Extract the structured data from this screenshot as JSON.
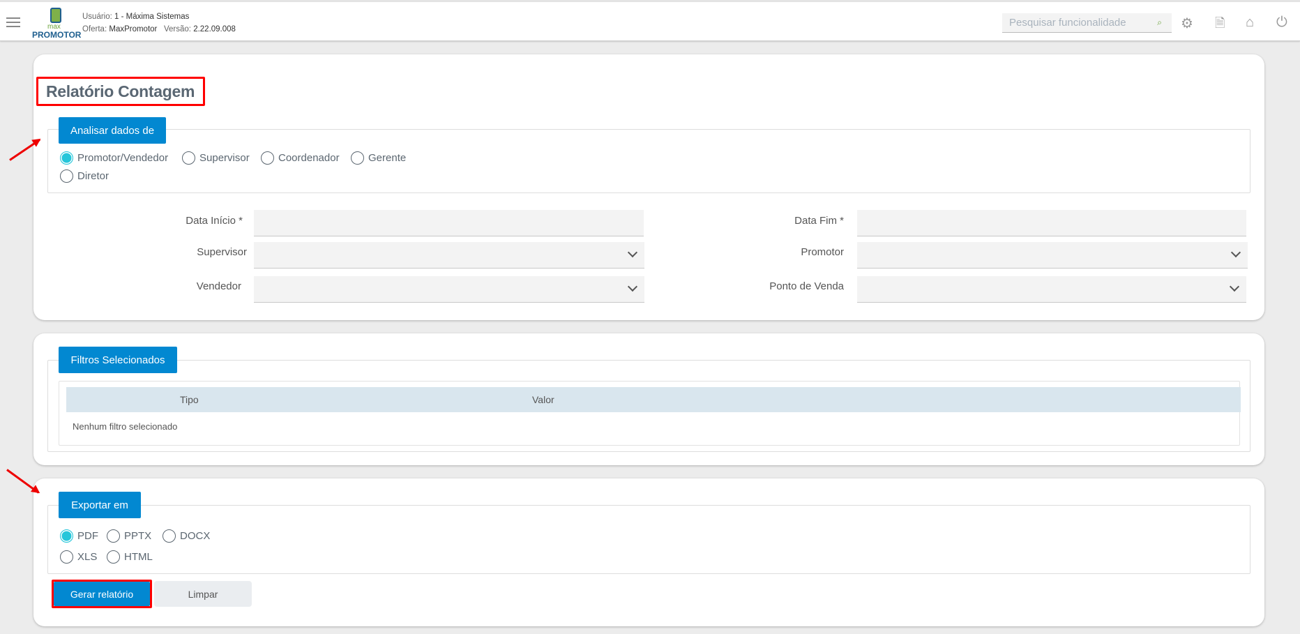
{
  "header": {
    "user_label": "Usuário:",
    "user_value": "1 - Máxima Sistemas",
    "offer_label": "Oferta:",
    "offer_value": "MaxPromotor",
    "version_label": "Versão:",
    "version_value": "2.22.09.008",
    "logo_small": "max",
    "logo_big": "PROMOTOR",
    "search_placeholder": "Pesquisar funcionalidade",
    "icons": [
      "menu-icon",
      "settings-icon",
      "document-icon",
      "home-icon",
      "power-icon"
    ]
  },
  "page": {
    "title": "Relatório Contagem"
  },
  "analisar": {
    "legend": "Analisar dados de",
    "options": [
      "Promotor/Vendedor",
      "Supervisor",
      "Coordenador",
      "Gerente",
      "Diretor"
    ],
    "selected": "Promotor/Vendedor"
  },
  "form": {
    "data_inicio": "Data Início",
    "data_fim": "Data Fim",
    "required": "*",
    "supervisor": "Supervisor",
    "promotor": "Promotor",
    "vendedor": "Vendedor",
    "ponto_venda": "Ponto de Venda"
  },
  "filtros": {
    "legend": "Filtros Selecionados",
    "col_tipo": "Tipo",
    "col_valor": "Valor",
    "empty": "Nenhum filtro selecionado"
  },
  "exportar": {
    "legend": "Exportar em",
    "options": [
      "PDF",
      "PPTX",
      "DOCX",
      "XLS",
      "HTML"
    ],
    "selected": "PDF"
  },
  "actions": {
    "generate": "Gerar relatório",
    "clear": "Limpar"
  },
  "colors": {
    "primary": "#0288d1",
    "radio_on": "#26c6da",
    "annotation": "#ff0000"
  }
}
